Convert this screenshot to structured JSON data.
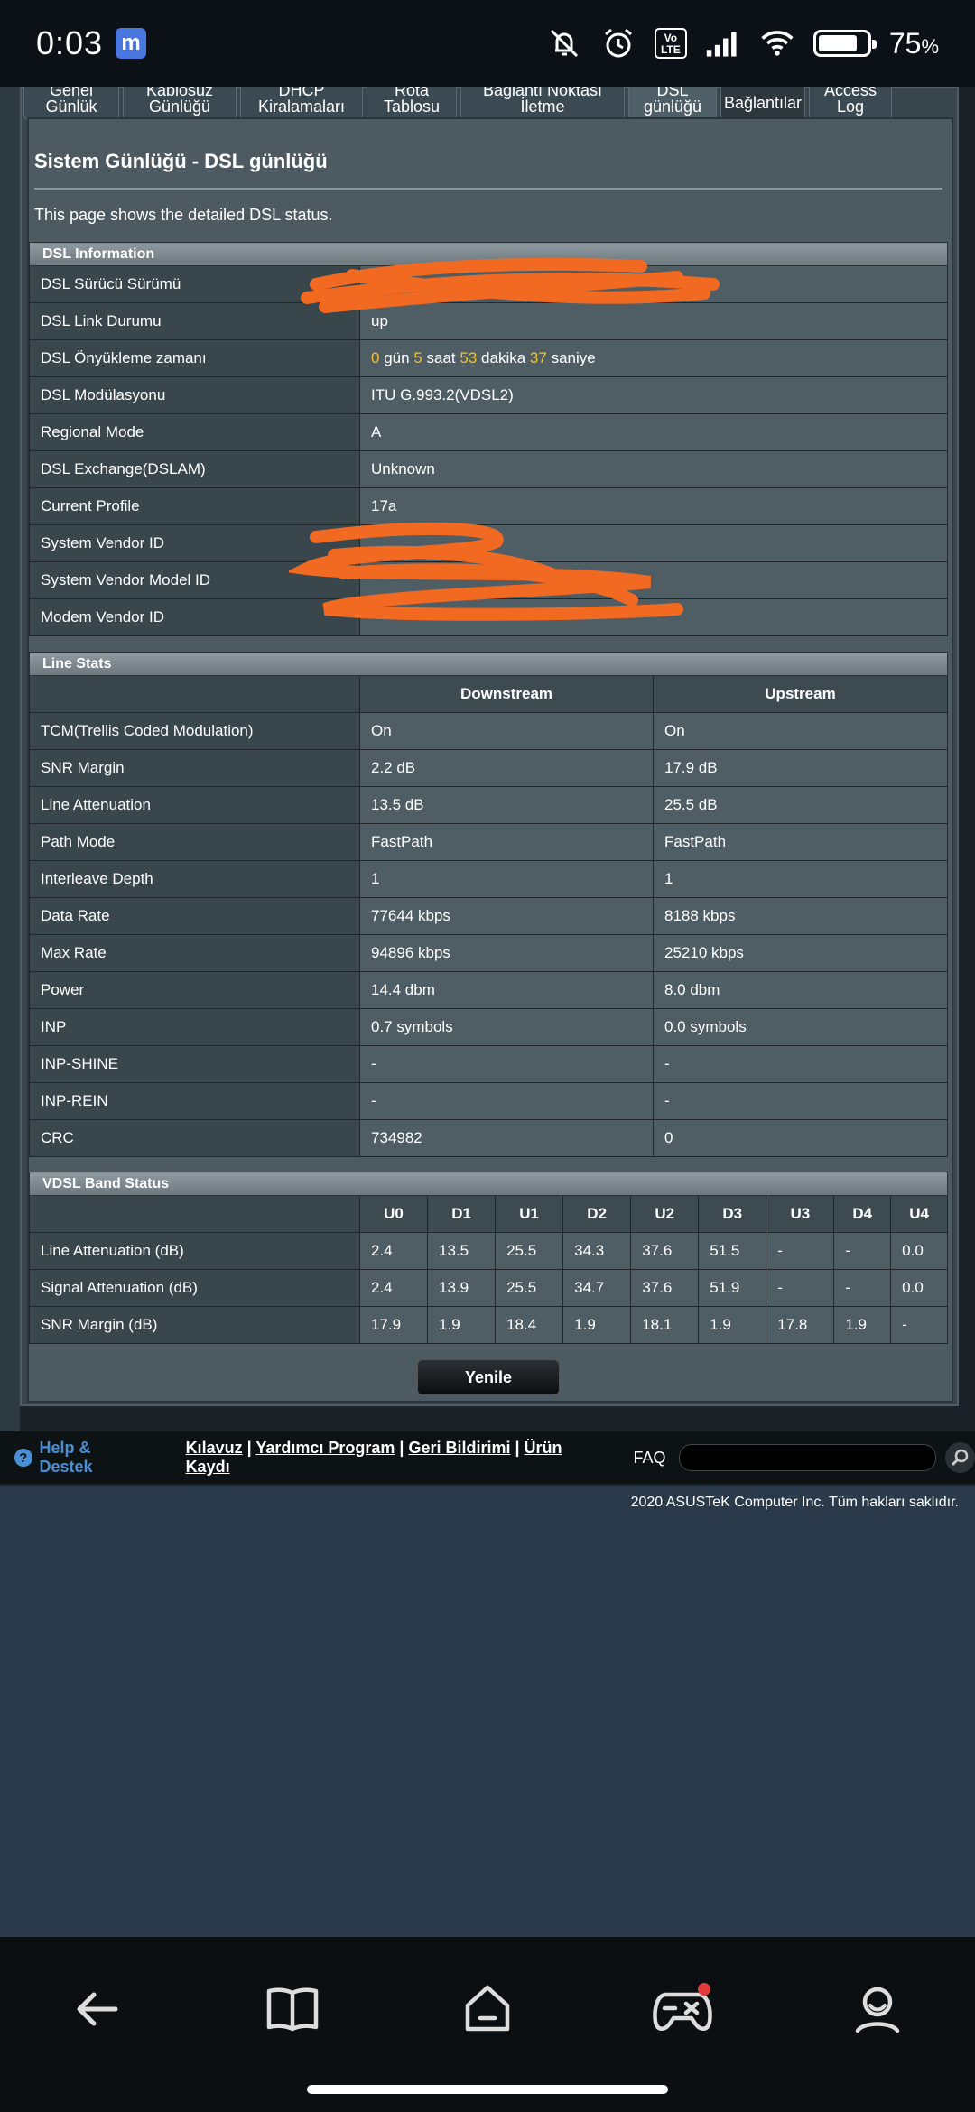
{
  "status": {
    "time": "0:03",
    "app_badge": "m",
    "volte": "Vo\nLTE",
    "battery": "75",
    "battery_unit": "%"
  },
  "tabs": [
    {
      "label": "Genel\nGünlük"
    },
    {
      "label": "Kablosuz\nGünlüğü"
    },
    {
      "label": "DHCP\nKiralamaları"
    },
    {
      "label": "Rota\nTablosu"
    },
    {
      "label": "Bağlantı Noktası\nİletme"
    },
    {
      "label": "DSL\ngünlüğü"
    },
    {
      "label": "Bağlantılar"
    },
    {
      "label": "Access\nLog"
    }
  ],
  "page": {
    "title": "Sistem Günlüğü - DSL günlüğü",
    "description": "This page shows the detailed DSL status."
  },
  "dsl_info": {
    "header": "DSL Information",
    "rows": [
      {
        "label": "DSL Sürücü Sürümü",
        "value": ""
      },
      {
        "label": "DSL Link Durumu",
        "value": "up"
      },
      {
        "label": "DSL Önyükleme zamanı",
        "value": ""
      },
      {
        "label": "DSL Modülasyonu",
        "value": "ITU G.993.2(VDSL2)"
      },
      {
        "label": "Regional Mode",
        "value": "A"
      },
      {
        "label": "DSL Exchange(DSLAM)",
        "value": "Unknown"
      },
      {
        "label": "Current Profile",
        "value": "17a"
      },
      {
        "label": "System Vendor ID",
        "value": ""
      },
      {
        "label": "System Vendor Model ID",
        "value": ""
      },
      {
        "label": "Modem Vendor ID",
        "value": ""
      }
    ],
    "uptime": {
      "days": "0",
      "days_unit": "gün",
      "hours": "5",
      "hours_unit": "saat",
      "minutes": "53",
      "minutes_unit": "dakika",
      "seconds": "37",
      "seconds_unit": "saniye"
    }
  },
  "line_stats": {
    "header": "Line Stats",
    "col_down": "Downstream",
    "col_up": "Upstream",
    "rows": [
      {
        "label": "TCM(Trellis Coded Modulation)",
        "down": "On",
        "up": "On"
      },
      {
        "label": "SNR Margin",
        "down": "2.2 dB",
        "up": "17.9 dB"
      },
      {
        "label": "Line Attenuation",
        "down": "13.5 dB",
        "up": "25.5 dB"
      },
      {
        "label": "Path Mode",
        "down": "FastPath",
        "up": "FastPath"
      },
      {
        "label": "Interleave Depth",
        "down": "1",
        "up": "1"
      },
      {
        "label": "Data Rate",
        "down": "77644 kbps",
        "up": "8188 kbps"
      },
      {
        "label": "Max Rate",
        "down": "94896 kbps",
        "up": "25210 kbps"
      },
      {
        "label": "Power",
        "down": "14.4 dbm",
        "up": "8.0 dbm"
      },
      {
        "label": "INP",
        "down": "0.7 symbols",
        "up": "0.0 symbols"
      },
      {
        "label": "INP-SHINE",
        "down": "-",
        "up": "-"
      },
      {
        "label": "INP-REIN",
        "down": "-",
        "up": "-"
      },
      {
        "label": "CRC",
        "down": "734982",
        "up": "0"
      }
    ]
  },
  "vdsl": {
    "header": "VDSL Band Status",
    "bands": [
      "U0",
      "D1",
      "U1",
      "D2",
      "U2",
      "D3",
      "U3",
      "D4",
      "U4"
    ],
    "rows": [
      {
        "label": "Line Attenuation (dB)",
        "values": [
          "2.4",
          "13.5",
          "25.5",
          "34.3",
          "37.6",
          "51.5",
          "-",
          "-",
          "0.0"
        ]
      },
      {
        "label": "Signal Attenuation (dB)",
        "values": [
          "2.4",
          "13.9",
          "25.5",
          "34.7",
          "37.6",
          "51.9",
          "-",
          "-",
          "0.0"
        ]
      },
      {
        "label": "SNR Margin (dB)",
        "values": [
          "17.9",
          "1.9",
          "18.4",
          "1.9",
          "18.1",
          "1.9",
          "17.8",
          "1.9",
          "-"
        ]
      }
    ]
  },
  "refresh_label": "Yenile",
  "footer": {
    "help": "Help & Destek",
    "links": [
      "Kılavuz",
      "Yardımcı Program",
      "Geri Bildirimi",
      "Ürün Kaydı"
    ],
    "separator": " | ",
    "faq": "FAQ",
    "copyright": "2020 ASUSTeK Computer Inc. Tüm hakları saklıdır."
  },
  "colors": {
    "upstream_band": "#38b6ec",
    "downstream_band": "#f3a23a",
    "uptime_number": "#f2c230",
    "redaction": "#f26a22"
  }
}
